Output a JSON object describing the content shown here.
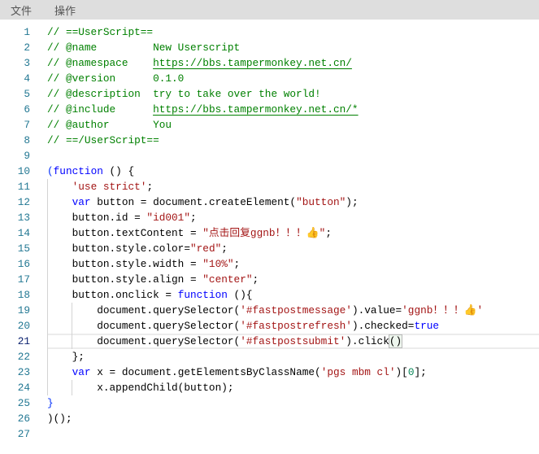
{
  "menu": [
    "文件",
    "操作"
  ],
  "editor": {
    "current_line": 21,
    "colors": {
      "comment": "#008000",
      "keyword": "#0000ff",
      "string": "#a31515",
      "number": "#098658",
      "line_number": "#237893"
    },
    "lines": [
      [
        [
          "comment",
          "// ==UserScript=="
        ]
      ],
      [
        [
          "comment",
          "// @name         New Userscript"
        ]
      ],
      [
        [
          "comment",
          "// @namespace    "
        ],
        [
          "link",
          "https://bbs.tampermonkey.net.cn/"
        ]
      ],
      [
        [
          "comment",
          "// @version      0.1.0"
        ]
      ],
      [
        [
          "comment",
          "// @description  try to take over the world!"
        ]
      ],
      [
        [
          "comment",
          "// @include      "
        ],
        [
          "link",
          "https://bbs.tampermonkey.net.cn/*"
        ]
      ],
      [
        [
          "comment",
          "// @author       You"
        ]
      ],
      [
        [
          "comment",
          "// ==/UserScript=="
        ]
      ],
      [],
      [
        [
          "bracket",
          "("
        ],
        [
          "keyword",
          "function"
        ],
        [
          "plain",
          " () {"
        ]
      ],
      [
        [
          "plain",
          "    "
        ],
        [
          "string",
          "'use strict'"
        ],
        [
          "plain",
          ";"
        ]
      ],
      [
        [
          "plain",
          "    "
        ],
        [
          "keyword",
          "var"
        ],
        [
          "plain",
          " button = document.createElement("
        ],
        [
          "string",
          "\"button\""
        ],
        [
          "plain",
          ");"
        ]
      ],
      [
        [
          "plain",
          "    button.id = "
        ],
        [
          "string",
          "\"id001\""
        ],
        [
          "plain",
          ";"
        ]
      ],
      [
        [
          "plain",
          "    button.textContent = "
        ],
        [
          "string",
          "\"点击回复ggnb！！！👍\""
        ],
        [
          "plain",
          ";"
        ]
      ],
      [
        [
          "plain",
          "    button.style.color="
        ],
        [
          "string",
          "\"red\""
        ],
        [
          "plain",
          ";"
        ]
      ],
      [
        [
          "plain",
          "    button.style.width = "
        ],
        [
          "string",
          "\"10%\""
        ],
        [
          "plain",
          ";"
        ]
      ],
      [
        [
          "plain",
          "    button.style.align = "
        ],
        [
          "string",
          "\"center\""
        ],
        [
          "plain",
          ";"
        ]
      ],
      [
        [
          "plain",
          "    button.onclick = "
        ],
        [
          "keyword",
          "function"
        ],
        [
          "plain",
          " (){"
        ]
      ],
      [
        [
          "plain",
          "        document.querySelector("
        ],
        [
          "string",
          "'#fastpostmessage'"
        ],
        [
          "plain",
          ").value="
        ],
        [
          "string",
          "'ggnb！！！👍'"
        ]
      ],
      [
        [
          "plain",
          "        document.querySelector("
        ],
        [
          "string",
          "'#fastpostrefresh'"
        ],
        [
          "plain",
          ").checked="
        ],
        [
          "keyword",
          "true"
        ]
      ],
      [
        [
          "plain",
          "        document.querySelector("
        ],
        [
          "string",
          "'#fastpostsubmit'"
        ],
        [
          "plain",
          ").click"
        ],
        [
          "match",
          "()"
        ]
      ],
      [
        [
          "plain",
          "    };"
        ]
      ],
      [
        [
          "plain",
          "    "
        ],
        [
          "keyword",
          "var"
        ],
        [
          "plain",
          " x = document.getElementsByClassName("
        ],
        [
          "string",
          "'pgs mbm cl'"
        ],
        [
          "plain",
          ")["
        ],
        [
          "number",
          "0"
        ],
        [
          "plain",
          "];"
        ]
      ],
      [
        [
          "plain",
          "        x.appendChild(button);"
        ]
      ],
      [
        [
          "bracket",
          "}"
        ]
      ],
      [
        [
          "plain",
          ")();"
        ]
      ],
      []
    ]
  }
}
